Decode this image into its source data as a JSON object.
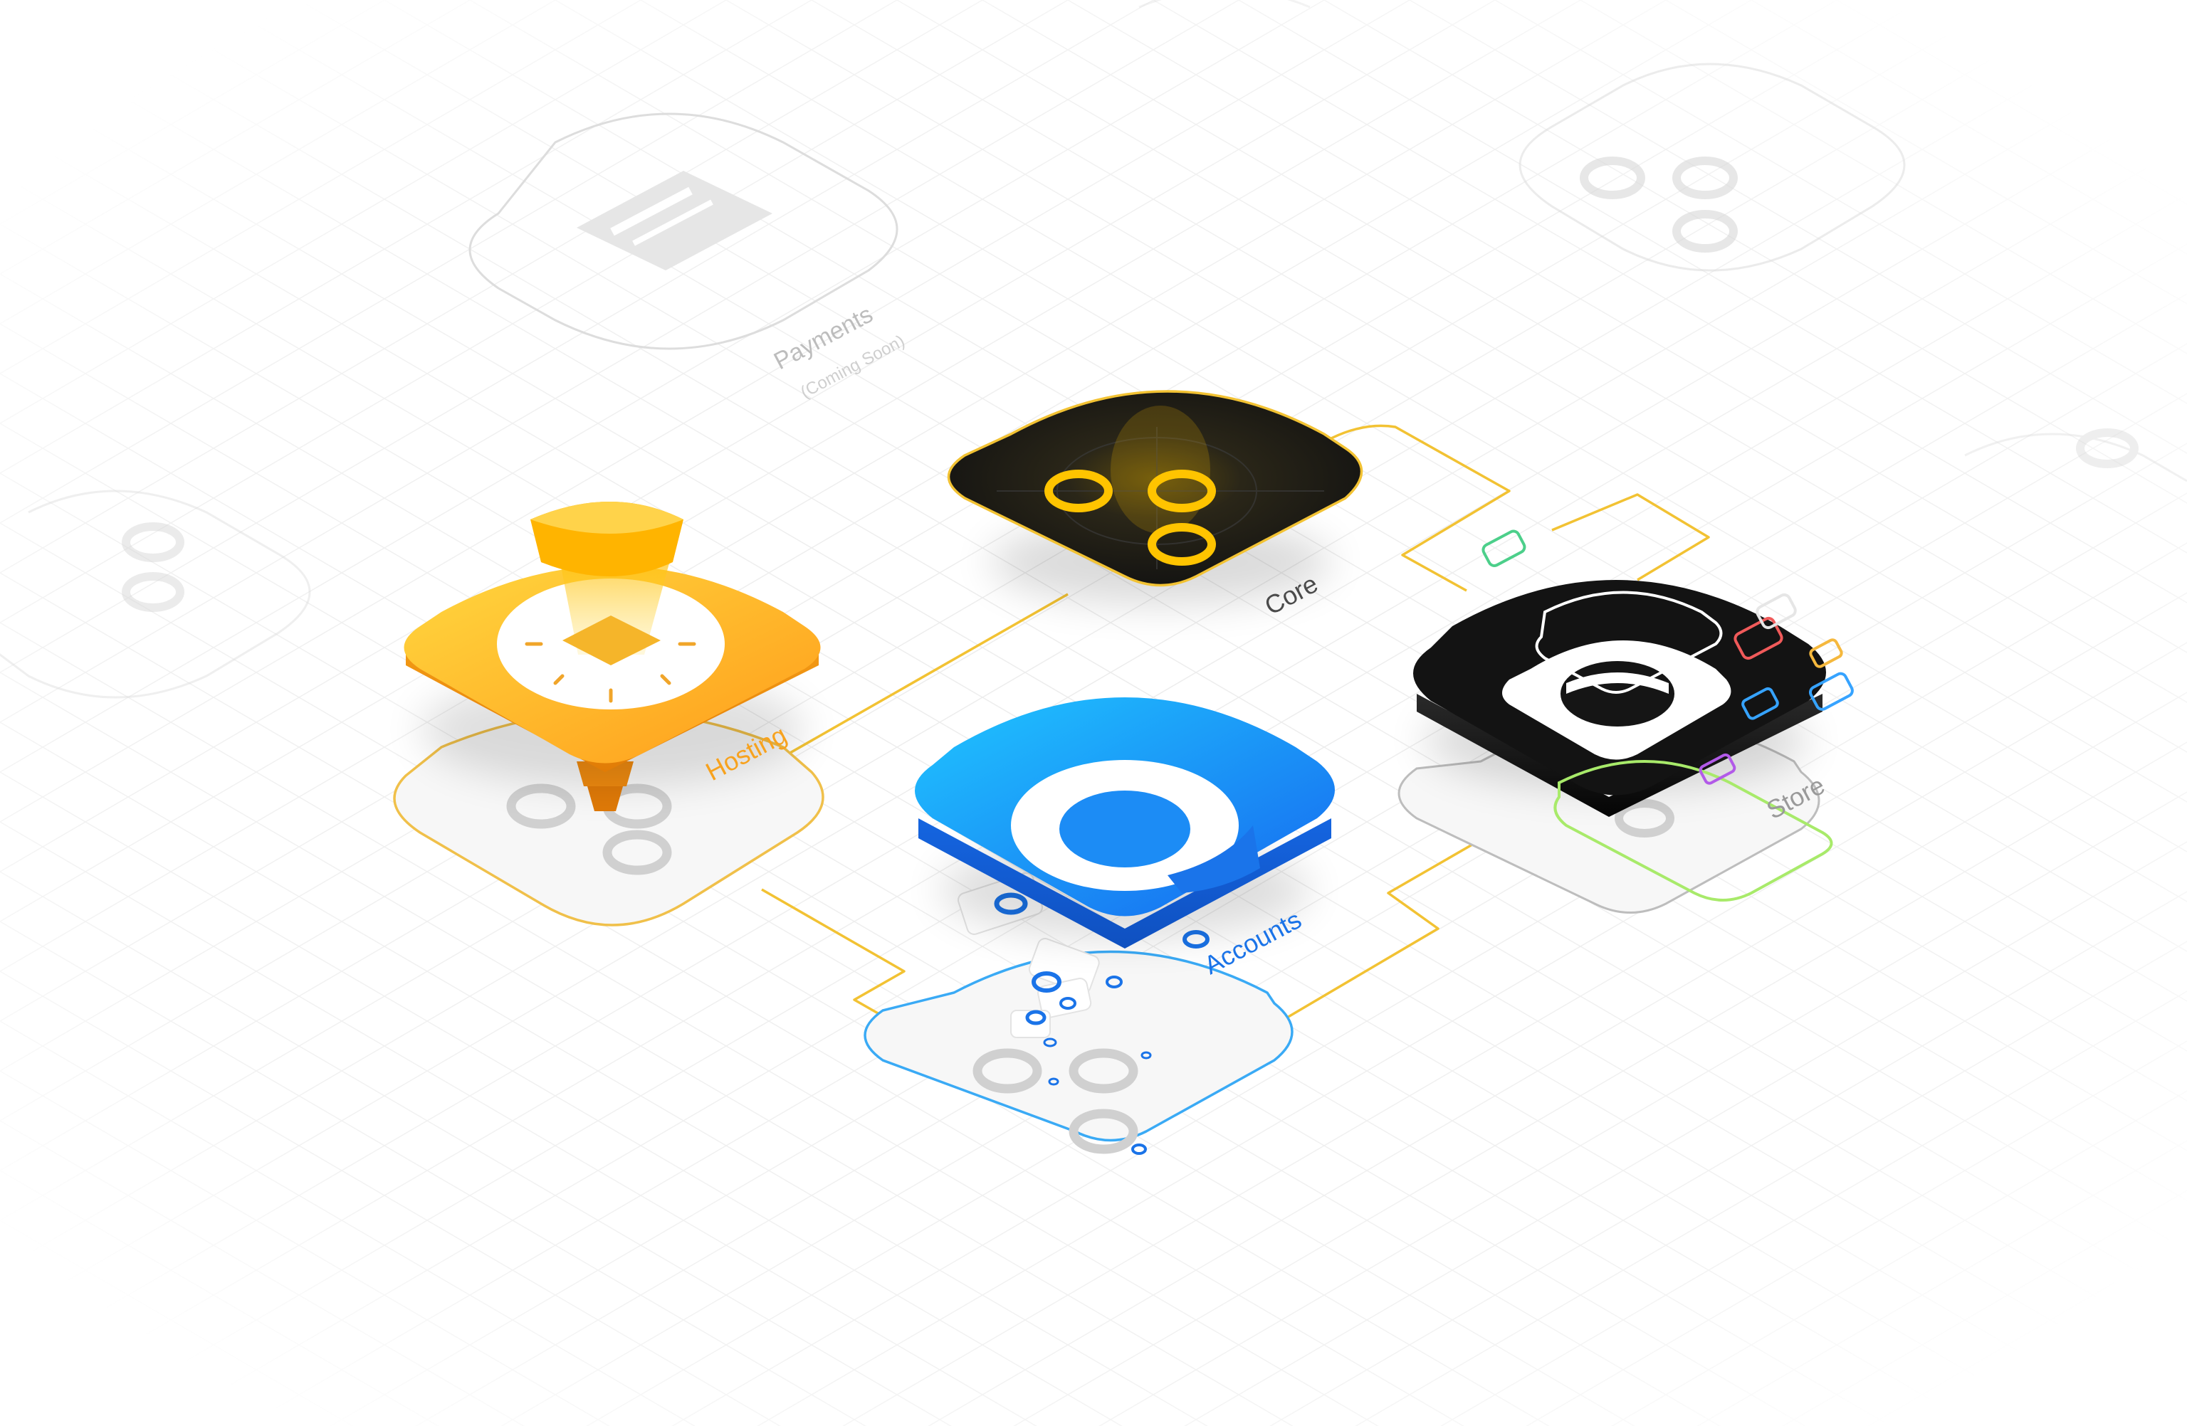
{
  "modules": {
    "payments": {
      "label": "Payments",
      "sublabel": "(Coming Soon)",
      "status": "disabled"
    },
    "core": {
      "label": "Core"
    },
    "hosting": {
      "label": "Hosting"
    },
    "accounts": {
      "label": "Accounts"
    },
    "store": {
      "label": "Store"
    }
  },
  "colors": {
    "background": "#ffffff",
    "grid": "#ececec",
    "connector": "#f2c233",
    "hosting_top": "#ffd23a",
    "hosting_bottom": "#ff9a18",
    "hosting_label": "#f7a21e",
    "core_dark": "#1c1c1c",
    "core_glow": "#ffc400",
    "accounts_top": "#1ec0ff",
    "accounts_bottom": "#1a6ef5",
    "accounts_label": "#1a73e8",
    "store_dark": "#141414",
    "store_outline": "#a8ea6a",
    "muted": "#c8c8c8",
    "muted_text": "#bdbdbd",
    "accent_green": "#4ccf8a",
    "accent_red": "#f05a5a",
    "accent_blue": "#36a3ff",
    "accent_purple": "#b25ae8",
    "accent_yellow": "#f5b83d"
  },
  "icons": [
    "credit-card-icon",
    "core-circles-icon",
    "hosting-beam-icon",
    "accounts-ring-icon",
    "store-bag-icon"
  ]
}
